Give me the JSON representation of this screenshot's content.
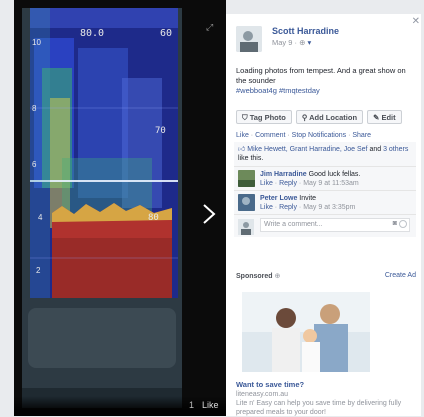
{
  "viewer": {
    "like_label": "Like",
    "dim_label": "1"
  },
  "post": {
    "author": "Scott Harradine",
    "time": "May 9 · ",
    "text": "Loading photos from tempest. And a great show on the sounder",
    "hashtags": "#webboat4g #tmqtestday",
    "buttons": [
      "Tag Photo",
      "Add Location",
      "Edit"
    ],
    "actions": [
      "Like",
      "Comment",
      "Stop Notifications",
      "Share"
    ]
  },
  "likes": {
    "names": "Mike Hewett, Grant Harradine, Joe Sef",
    "and": " and ",
    "others": "3 others",
    "suffix": " like this."
  },
  "comments": [
    {
      "who": "Jim Harradine",
      "text": " Good luck fellas.",
      "like": "Like",
      "reply": "Reply",
      "time": " · May 9 at 11:53am"
    },
    {
      "who": "Peter Lowe",
      "text": " Invite",
      "like": "Like",
      "reply": "Reply",
      "time": " · May 9 at 3:35pm"
    }
  ],
  "write_comment": {
    "placeholder": "Write a comment..."
  },
  "sidebar_ad": {
    "sponsored": "Sponsored",
    "create_ad": "Create Ad",
    "title": "Want to save time?",
    "domain": "liteneasy.com.au",
    "description": "Lite n' Easy can help you save time by delivering fully prepared meals to your door!"
  },
  "colors": {
    "fb_blue": "#3b5998",
    "muted": "#90949c",
    "text": "#1d2129"
  },
  "sounder_display": {
    "readouts": [
      "80.0",
      "60",
      "70",
      "80"
    ],
    "scale_numbers": [
      "10",
      "8",
      "6",
      "4",
      "2"
    ]
  },
  "icons": [
    "expand-icon",
    "close-icon",
    "next-arrow-icon",
    "tag-icon",
    "location-icon",
    "edit-pencil-icon",
    "thumbs-up-icon",
    "camera-icon",
    "smile-icon",
    "globe-icon"
  ]
}
